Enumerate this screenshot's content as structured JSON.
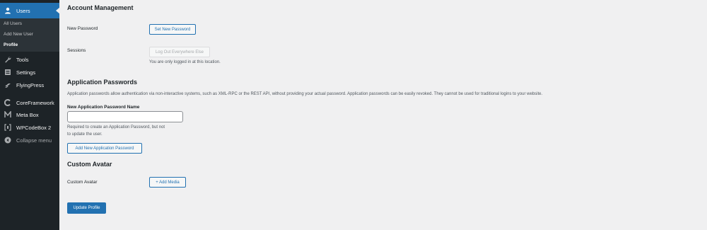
{
  "sidebar": {
    "active": {
      "label": "Users",
      "icon": "user-icon"
    },
    "submenu": [
      "All Users",
      "Add New User",
      "Profile"
    ],
    "items": [
      {
        "label": "Tools",
        "icon": "wrench-icon"
      },
      {
        "label": "Settings",
        "icon": "settings-icon"
      },
      {
        "label": "FlyingPress",
        "icon": "flyingpress-icon"
      },
      {
        "label": "CoreFramework",
        "icon": "coreframework-icon"
      },
      {
        "label": "Meta Box",
        "icon": "metabox-icon"
      },
      {
        "label": "WPCodeBox 2",
        "icon": "wpcodebox-icon"
      },
      {
        "label": "Collapse menu",
        "icon": "collapse-icon"
      }
    ]
  },
  "account": {
    "heading": "Account Management",
    "new_password_label": "New Password",
    "set_password_button": "Set New Password",
    "sessions_label": "Sessions",
    "logout_button": "Log Out Everywhere Else",
    "sessions_note": "You are only logged in at this location."
  },
  "app_passwords": {
    "heading": "Application Passwords",
    "description": "Application passwords allow authentication via non-interactive systems, such as XML-RPC or the REST API, without providing your actual password. Application passwords can be easily revoked. They cannot be used for traditional logins to your website.",
    "name_label": "New Application Password Name",
    "name_value": "",
    "help_line1": "Required to create an Application Password, but not",
    "help_line2": "to update the user.",
    "add_button": "Add New Application Password"
  },
  "custom_avatar": {
    "heading": "Custom Avatar",
    "label": "Custom Avatar",
    "add_media_button": "+ Add Media"
  },
  "update_button": "Update Profile",
  "colors": {
    "sidebar_bg": "#1d2327",
    "submenu_bg": "#2c3338",
    "accent": "#2271b1",
    "page_bg": "#f0f0f1"
  }
}
